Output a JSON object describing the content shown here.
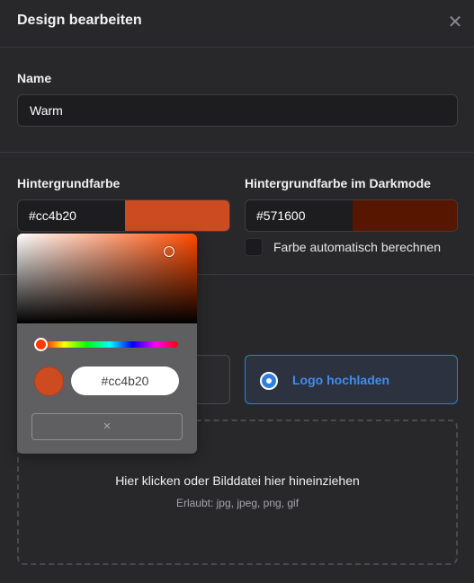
{
  "header": {
    "title": "Design bearbeiten"
  },
  "name_section": {
    "label": "Name",
    "value": "Warm"
  },
  "colors": {
    "background_label": "Hintergrundfarbe",
    "background_value": "#cc4b20",
    "background_swatch": "#cc4b20",
    "dark_label": "Hintergrundfarbe im Darkmode",
    "dark_value": "#571600",
    "dark_swatch": "#571600",
    "auto_calc_label": "Farbe automatisch berechnen"
  },
  "options": {
    "logo_upload_label": "Logo hochladen"
  },
  "dropzone": {
    "title": "Hier klicken oder Bilddatei hier hineinziehen",
    "subtitle": "Erlaubt: jpg, jpeg, png, gif"
  },
  "picker": {
    "hex_value": "#cc4b20",
    "clear_symbol": "×"
  },
  "icons": {
    "close": "close-icon"
  }
}
